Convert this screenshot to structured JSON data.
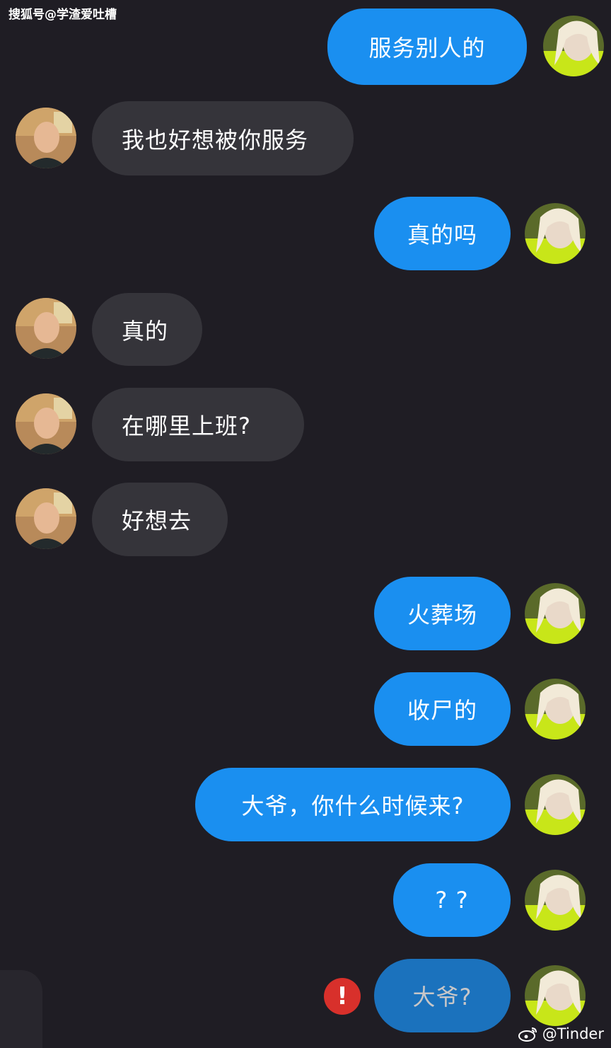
{
  "watermark_top": "搜狐号@学渣爱吐槽",
  "watermark_bottom": "@Tinder",
  "messages": [
    {
      "from": "me",
      "text": "服务别人的"
    },
    {
      "from": "them",
      "text": "我也好想被你服务"
    },
    {
      "from": "me",
      "text": "真的吗"
    },
    {
      "from": "them",
      "text": "真的"
    },
    {
      "from": "them",
      "text": "在哪里上班?"
    },
    {
      "from": "them",
      "text": "好想去"
    },
    {
      "from": "me",
      "text": "火葬场"
    },
    {
      "from": "me",
      "text": "收尸的"
    },
    {
      "from": "me",
      "text": "大爷，你什么时候来?"
    },
    {
      "from": "me",
      "text": "? ?"
    },
    {
      "from": "me",
      "text": "大爷?",
      "status": "failed"
    }
  ],
  "error_badge": "!",
  "colors": {
    "background": "#1f1d24",
    "me_bubble": "#1a8ff0",
    "them_bubble": "#35343a",
    "error": "#d8302b"
  }
}
